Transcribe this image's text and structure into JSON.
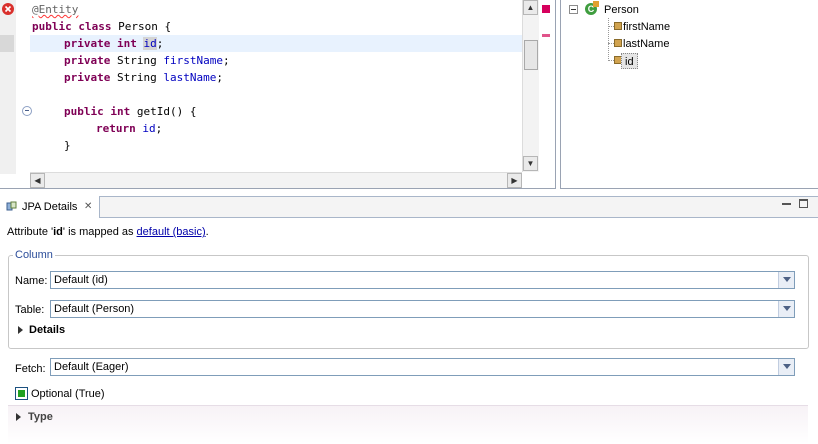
{
  "editor": {
    "code": {
      "line1_annotation": "@Entity",
      "line2": {
        "kw": "public class",
        "rest": " Person {"
      },
      "line3": {
        "kw": "private int",
        "field": "id",
        "end": ";"
      },
      "line4": {
        "kw": "private",
        "type": " String ",
        "field": "firstName",
        "end": ";"
      },
      "line5": {
        "kw": "private",
        "type": " String ",
        "field": "lastName",
        "end": ";"
      },
      "line7": {
        "kw": "public int",
        "rest": " getId() {"
      },
      "line8": {
        "kw": "return",
        "field": "id",
        "end": ";"
      },
      "line9": "}"
    }
  },
  "outline": {
    "root": "Person",
    "items": [
      "firstName",
      "lastName",
      "id"
    ],
    "collapse_symbol": "⊟"
  },
  "panel": {
    "tab_label": "JPA Details",
    "tab_close": "✕",
    "attribute_text": {
      "prefix": "Attribute '",
      "name": "id",
      "middle": "' is mapped as ",
      "link": "default (basic)",
      "suffix": "."
    },
    "column_group": "Column",
    "name_label": "Name:",
    "name_value": "Default (id)",
    "table_label": "Table:",
    "table_value": "Default (Person)",
    "details_label": "Details",
    "fetch_label": "Fetch:",
    "fetch_value": "Default (Eager)",
    "optional_label": "Optional (True)",
    "type_label": "Type"
  }
}
